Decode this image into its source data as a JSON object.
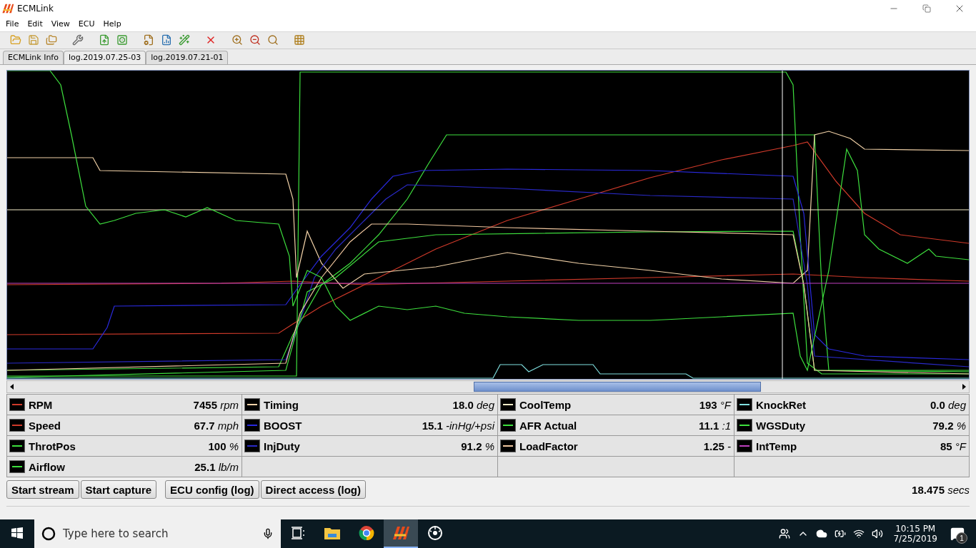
{
  "window": {
    "title": "ECMLink"
  },
  "menu": [
    {
      "label": "File"
    },
    {
      "label": "Edit"
    },
    {
      "label": "View"
    },
    {
      "label": "ECU"
    },
    {
      "label": "Help"
    }
  ],
  "tabs": [
    {
      "label": "ECMLink Info",
      "selected": false
    },
    {
      "label": "log.2019.07.25-03",
      "selected": true
    },
    {
      "label": "log.2019.07.21-01",
      "selected": false
    }
  ],
  "channel_columns": [
    [
      {
        "name": "RPM",
        "value": "7455",
        "unit": "rpm",
        "color": "#d03a2a"
      },
      {
        "name": "Speed",
        "value": "67.7",
        "unit": "mph",
        "color": "#d03a2a"
      },
      {
        "name": "ThrotPos",
        "value": "100",
        "unit": "%",
        "color": "#3ee03e"
      },
      {
        "name": "Airflow",
        "value": "25.1",
        "unit": "lb/m",
        "color": "#3ee03e"
      }
    ],
    [
      {
        "name": "Timing",
        "value": "18.0",
        "unit": "deg",
        "color": "#f2d2a8"
      },
      {
        "name": "BOOST",
        "value": "15.1",
        "unit": "-inHg/+psi",
        "color": "#2a2ae0"
      },
      {
        "name": "InjDuty",
        "value": "91.2",
        "unit": "%",
        "color": "#2a2ac8"
      }
    ],
    [
      {
        "name": "CoolTemp",
        "value": "193",
        "unit": "°F",
        "color": "#f4ecc8"
      },
      {
        "name": "AFR Actual",
        "value": "11.1",
        "unit": ":1",
        "color": "#3ee03e"
      },
      {
        "name": "LoadFactor",
        "value": "1.25",
        "unit": "-",
        "color": "#f2c8a0"
      }
    ],
    [
      {
        "name": "KnockRet",
        "value": "0.0",
        "unit": "deg",
        "color": "#80e0e0"
      },
      {
        "name": "WGSDuty",
        "value": "79.2",
        "unit": "%",
        "color": "#3ee03e"
      },
      {
        "name": "IntTemp",
        "value": "85",
        "unit": "°F",
        "color": "#c040c0"
      }
    ]
  ],
  "buttons": [
    {
      "label": "Start stream"
    },
    {
      "label": "Start capture"
    },
    {
      "label": "ECU config (log)"
    },
    {
      "label": "Direct access (log)"
    }
  ],
  "elapsed": {
    "value": "18.475",
    "unit": "secs"
  },
  "taskbar": {
    "search": {
      "placeholder": "Type here to search"
    },
    "apps": [
      {
        "kind": "taskview",
        "selected": false
      },
      {
        "kind": "explorer",
        "selected": false
      },
      {
        "kind": "chrome",
        "selected": false
      },
      {
        "kind": "ecmlink",
        "selected": true
      },
      {
        "kind": "dial",
        "selected": false
      }
    ],
    "time": "10:15 PM",
    "date": "7/25/2019",
    "notifications": "1"
  }
}
